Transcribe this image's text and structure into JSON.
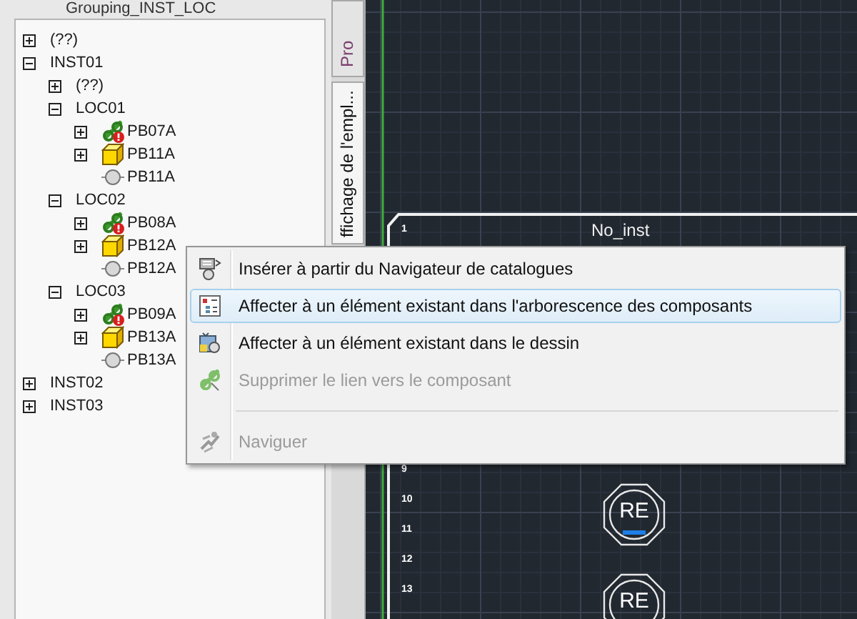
{
  "panel": {
    "title": "Grouping_INST_LOC",
    "tree": [
      {
        "label": "(??)",
        "expanded": false
      },
      {
        "label": "INST01",
        "expanded": true,
        "children": [
          {
            "label": "(??)",
            "expanded": false
          },
          {
            "label": "LOC01",
            "expanded": true,
            "children": [
              {
                "label": "PB07A",
                "kind": "link-error",
                "expanded": false
              },
              {
                "label": "PB11A",
                "kind": "block",
                "expanded": false
              },
              {
                "label": "PB11A",
                "kind": "point"
              }
            ]
          },
          {
            "label": "LOC02",
            "expanded": true,
            "children": [
              {
                "label": "PB08A",
                "kind": "link-error",
                "expanded": false
              },
              {
                "label": "PB12A",
                "kind": "block",
                "expanded": false
              },
              {
                "label": "PB12A",
                "kind": "point"
              }
            ]
          },
          {
            "label": "LOC03",
            "expanded": true,
            "children": [
              {
                "label": "PB09A",
                "kind": "link-error",
                "expanded": false
              },
              {
                "label": "PB13A",
                "kind": "block",
                "expanded": false
              },
              {
                "label": "PB13A",
                "kind": "point"
              }
            ]
          }
        ]
      },
      {
        "label": "INST02",
        "expanded": false
      },
      {
        "label": "INST03",
        "expanded": false
      }
    ]
  },
  "side_tabs": [
    {
      "label": "Pro",
      "selected": false
    },
    {
      "label": "ffichage de l'empl...",
      "selected": true
    }
  ],
  "cad": {
    "frame_title": "No_inst",
    "row_numbers": [
      "1",
      "9",
      "10",
      "11",
      "12",
      "13"
    ],
    "symbols": [
      {
        "label": "RE"
      },
      {
        "label": "RE"
      }
    ]
  },
  "context_menu": {
    "sections": [
      {
        "items": [
          {
            "label": "Insérer à partir du Navigateur de catalogues",
            "kind": "insert",
            "disabled": false,
            "selected": false
          },
          {
            "label": "Affecter à un élément existant dans l'arborescence des composants",
            "kind": "tree",
            "disabled": false,
            "selected": true
          },
          {
            "label": "Affecter à un élément existant dans le dessin",
            "kind": "drawing",
            "disabled": false,
            "selected": false
          },
          {
            "label": "Supprimer le lien vers le composant",
            "kind": "unlink",
            "disabled": true,
            "selected": false
          }
        ]
      },
      {
        "items": [
          {
            "label": "Naviguer",
            "kind": "navigate",
            "disabled": true,
            "selected": false
          }
        ]
      }
    ]
  }
}
